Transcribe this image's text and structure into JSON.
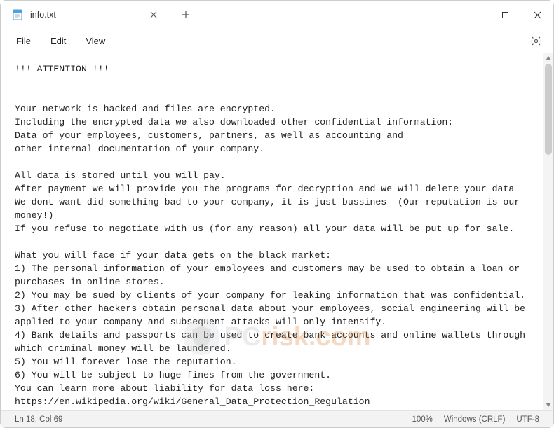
{
  "tab": {
    "title": "info.txt"
  },
  "menu": {
    "file": "File",
    "edit": "Edit",
    "view": "View"
  },
  "content": "!!! ATTENTION !!!\n\n\nYour network is hacked and files are encrypted.\nIncluding the encrypted data we also downloaded other confidential information:\nData of your employees, customers, partners, as well as accounting and\nother internal documentation of your company.\n\nAll data is stored until you will pay.\nAfter payment we will provide you the programs for decryption and we will delete your data\nWe dont want did something bad to your company, it is just bussines  (Our reputation is our money!)\nIf you refuse to negotiate with us (for any reason) all your data will be put up for sale.\n\nWhat you will face if your data gets on the black market:\n1) The personal information of your employees and customers may be used to obtain a loan or purchases in online stores.\n2) You may be sued by clients of your company for leaking information that was confidential.\n3) After other hackers obtain personal data about your employees, social engineering will be applied to your company and subsequent attacks will only intensify.\n4) Bank details and passports can be used to create bank accounts and online wallets through which criminal money will be laundered.\n5) You will forever lose the reputation.\n6) You will be subject to huge fines from the government.\nYou can learn more about liability for data loss here:\nhttps://en.wikipedia.org/wiki/General_Data_Protection_Regulation\nhttps://gdpr-info.eu/\nDebts, fines and the inability to use important files will lead you to huge losses.",
  "status": {
    "cursor": "Ln 18, Col 69",
    "zoom": "100%",
    "line_ending": "Windows (CRLF)",
    "encoding": "UTF-8"
  },
  "watermark": {
    "prefix": "PC",
    "suffix": "risk",
    "tld": ".com"
  }
}
